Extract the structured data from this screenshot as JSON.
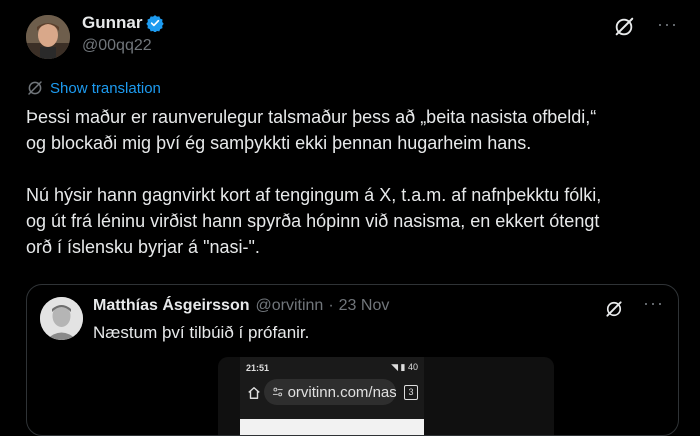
{
  "tweet": {
    "author_name": "Gunnar",
    "author_handle": "@00qq22",
    "show_translation": "Show translation",
    "body": "Þessi maður er raunverulegur talsmaður þess að „beita nasista ofbeldi,“\nog blockaði mig því ég samþykkti ekki þennan hugarheim hans.\n\nNú hýsir hann gagnvirkt kort af tengingum á X, t.a.m. af nafnþekktu fólki,\nog út frá léninu virðist hann spyrða hópinn við nasisma, en ekkert ótengt\norð í íslensku byrjar á \"nasi-\".",
    "more": "···"
  },
  "quoted": {
    "author_name": "Matthías Ásgeirsson",
    "author_handle": "@orvitinn",
    "separator": "·",
    "date": "23 Nov",
    "text": "Næstum því tilbúið í prófanir.",
    "more": "···",
    "phone": {
      "time": "21:51",
      "status_right": "◥ ▮ 40",
      "url": "orvitinn.com/nasi",
      "tab_count": "3"
    }
  },
  "colors": {
    "background": "#000000",
    "link": "#1d9bf0",
    "verified": "#1d9bf0",
    "muted": "#71767b"
  }
}
